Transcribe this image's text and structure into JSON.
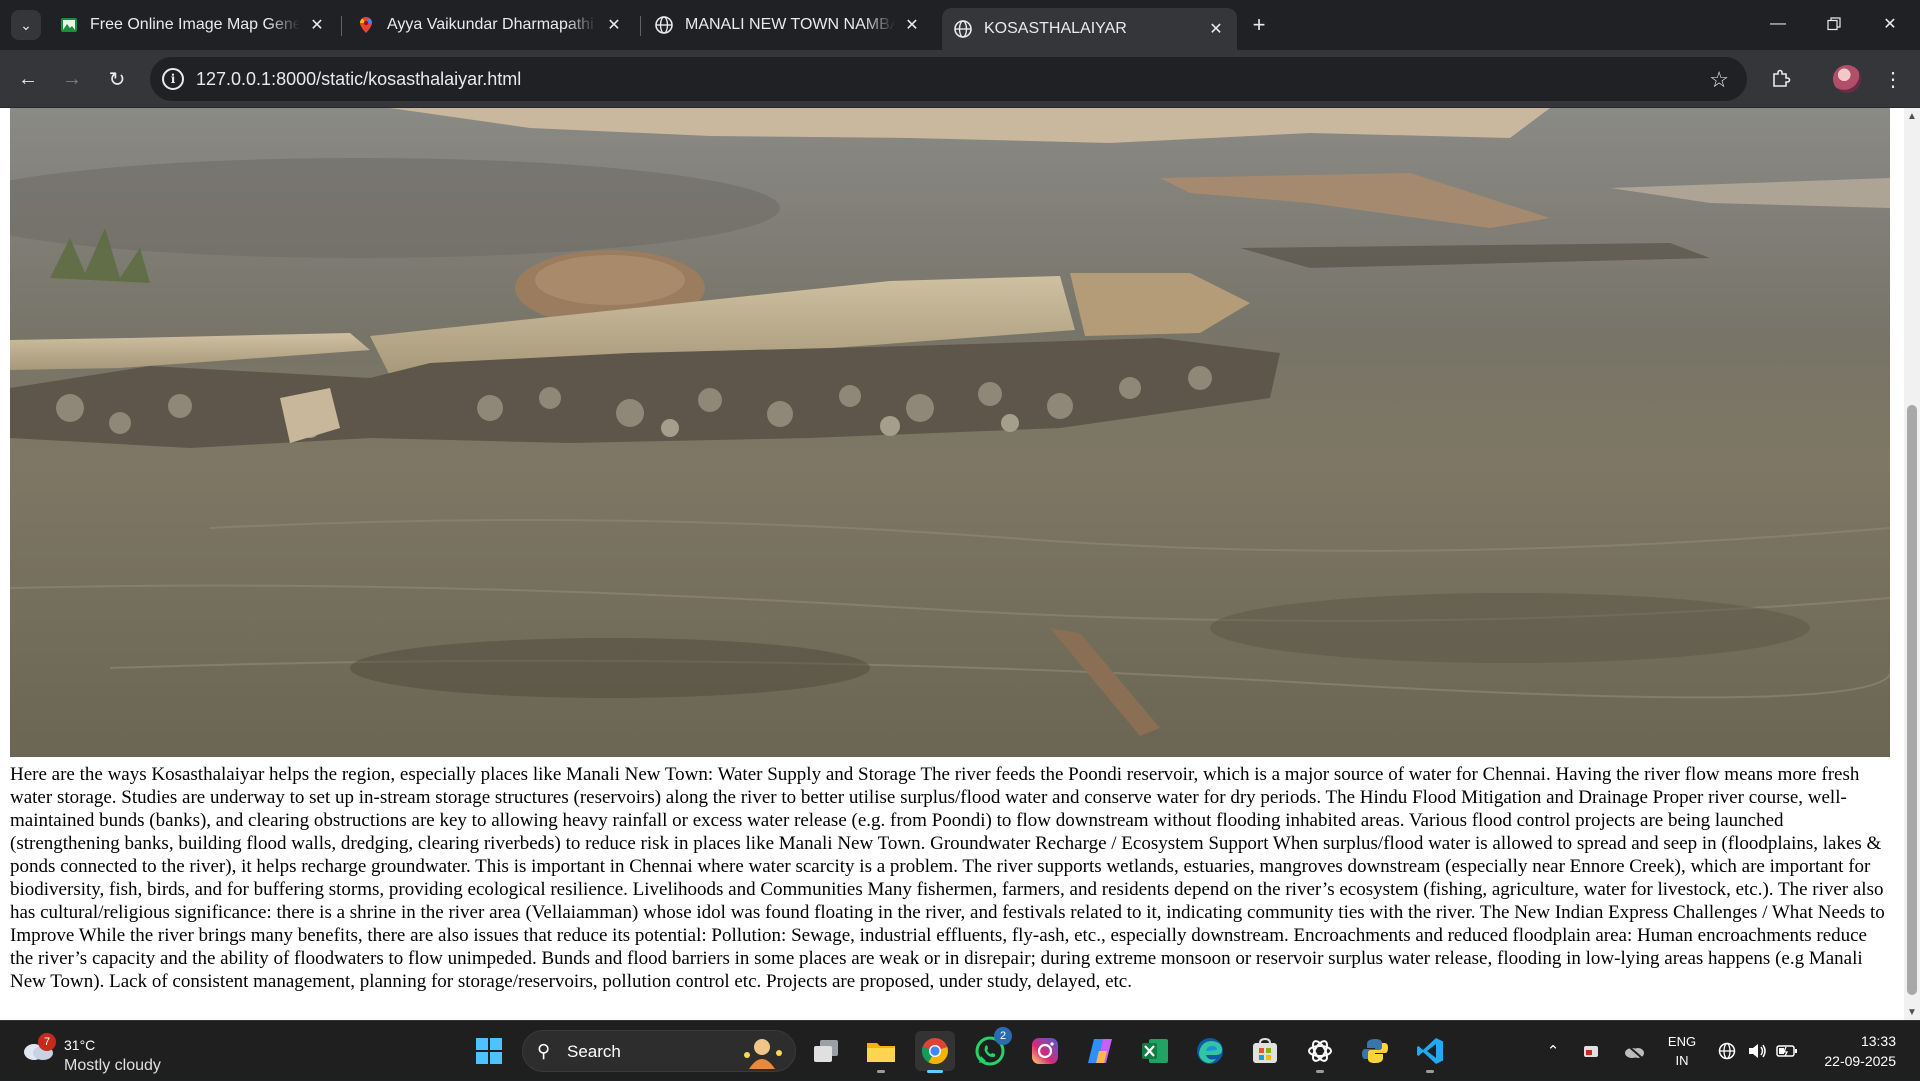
{
  "browser": {
    "tabs": [
      {
        "title": "Free Online Image Map Generator",
        "icon": "image-map-favicon",
        "active": false
      },
      {
        "title": "Ayya Vaikundar Dharmapathi - Google Maps",
        "icon": "google-maps-favicon",
        "active": false
      },
      {
        "title": "MANALI NEW TOWN NAMBA ENGAL",
        "icon": "globe-favicon",
        "active": false
      },
      {
        "title": "KOSASTHALAIYAR",
        "icon": "globe-favicon",
        "active": true
      }
    ],
    "new_tab_label": "+",
    "url": "127.0.0.1:8000/static/kosasthalaiyar.html"
  },
  "page": {
    "hero_alt": "Check dam across the Kosasthalaiyar river",
    "article_text": "Here are the ways Kosasthalaiyar helps the region, especially places like Manali New Town: Water Supply and Storage The river feeds the Poondi reservoir, which is a major source of water for Chennai. Having the river flow means more fresh water storage. Studies are underway to set up in-stream storage structures (reservoirs) along the river to better utilise surplus/flood water and conserve water for dry periods. The Hindu Flood Mitigation and Drainage Proper river course, well-maintained bunds (banks), and clearing obstructions are key to allowing heavy rainfall or excess water release (e.g. from Poondi) to flow downstream without flooding inhabited areas. Various flood control projects are being launched (strengthening banks, building flood walls, dredging, clearing riverbeds) to reduce risk in places like Manali New Town. Groundwater Recharge / Ecosystem Support When surplus/flood water is allowed to spread and seep in (floodplains, lakes & ponds connected to the river), it helps recharge groundwater. This is important in Chennai where water scarcity is a problem. The river supports wetlands, estuaries, mangroves downstream (especially near Ennore Creek), which are important for biodiversity, fish, birds, and for buffering storms, providing ecological resilience. Livelihoods and Communities Many fishermen, farmers, and residents depend on the river’s ecosystem (fishing, agriculture, water for livestock, etc.). The river also has cultural/religious significance: there is a shrine in the river area (Vellaiamman) whose idol was found floating in the river, and festivals related to it, indicating community ties with the river. The New Indian Express Challenges / What Needs to Improve While the river brings many benefits, there are also issues that reduce its potential: Pollution: Sewage, industrial effluents, fly-ash, etc., especially downstream. Encroachments and reduced floodplain area: Human encroachments reduce the river’s capacity and the ability of floodwaters to flow unimpeded. Bunds and flood barriers in some places are weak or in disrepair; during extreme monsoon or reservoir surplus water release, flooding in low-lying areas happens (e.g Manali New Town). Lack of consistent management, planning for storage/reservoirs, pollution control etc. Projects are proposed, under study, delayed, etc."
  },
  "taskbar": {
    "weather": {
      "temp": "31°C",
      "condition": "Mostly cloudy",
      "badge": "7"
    },
    "search_label": "Search",
    "apps": [
      {
        "name": "start-button",
        "running": false
      },
      {
        "name": "task-view-app",
        "running": false
      },
      {
        "name": "file-explorer-app",
        "running": true
      },
      {
        "name": "chrome-app",
        "running": true,
        "active": true
      },
      {
        "name": "whatsapp-app",
        "running": false,
        "badge": "2"
      },
      {
        "name": "instagram-app",
        "running": false
      },
      {
        "name": "copilot-app",
        "running": false
      },
      {
        "name": "excel-app",
        "running": false
      },
      {
        "name": "edge-app",
        "running": false
      },
      {
        "name": "store-app",
        "running": false
      },
      {
        "name": "chatgpt-app",
        "running": true
      },
      {
        "name": "python-app",
        "running": false
      },
      {
        "name": "vscode-app",
        "running": true
      }
    ],
    "tray": {
      "language_top": "ENG",
      "language_bottom": "IN"
    },
    "clock": {
      "time": "13:33",
      "date": "22-09-2025"
    }
  },
  "colors": {
    "tab_strip": "#202124",
    "toolbar": "#35363a",
    "taskbar": "#1f1f1f",
    "accent": "#60cdff"
  }
}
